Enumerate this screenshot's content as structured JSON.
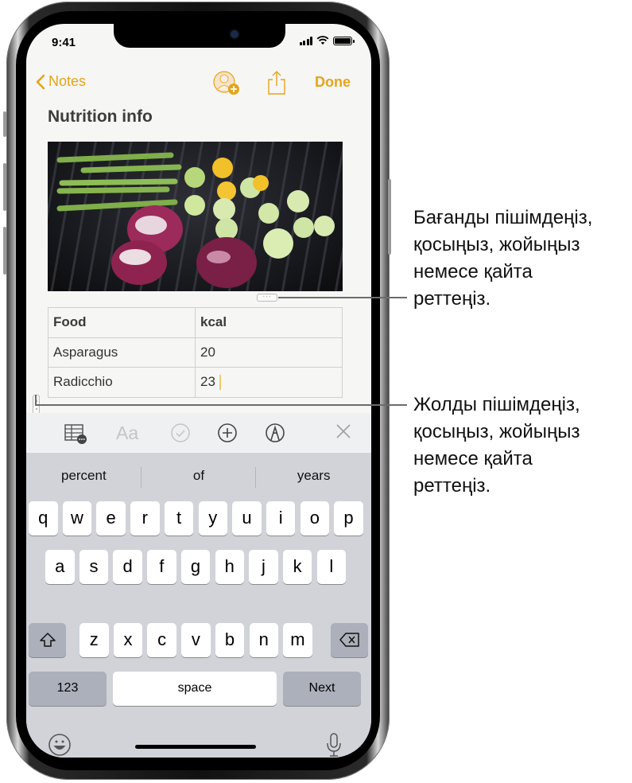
{
  "status_bar": {
    "time": "9:41",
    "battery_level": 1.0
  },
  "nav": {
    "back_label": "Notes",
    "done_label": "Done"
  },
  "note": {
    "title": "Nutrition info"
  },
  "table": {
    "headers": [
      "Food",
      "kcal"
    ],
    "rows": [
      [
        "Asparagus",
        "20"
      ],
      [
        "Radicchio",
        "23"
      ]
    ]
  },
  "toolbar": {
    "icons": [
      "table-icon",
      "text-format-icon",
      "checklist-icon",
      "add-icon",
      "markup-icon",
      "close-icon"
    ]
  },
  "suggestions": [
    "percent",
    "of",
    "years"
  ],
  "keyboard": {
    "row1": [
      "q",
      "w",
      "e",
      "r",
      "t",
      "y",
      "u",
      "i",
      "o",
      "p"
    ],
    "row2": [
      "a",
      "s",
      "d",
      "f",
      "g",
      "h",
      "j",
      "k",
      "l"
    ],
    "row3": [
      "z",
      "x",
      "c",
      "v",
      "b",
      "n",
      "m"
    ],
    "numbers_label": "123",
    "space_label": "space",
    "next_label": "Next"
  },
  "callouts": {
    "column": [
      "Бағанды пішімдеңіз,",
      "қосыңыз, жойыңыз",
      "немесе қайта",
      "реттеңіз."
    ],
    "row": [
      "Жолды пішімдеңіз,",
      "қосыңыз, жойыңыз",
      "немесе қайта",
      "реттеңіз."
    ]
  },
  "colors": {
    "accent": "#e5a41b",
    "keyboard_bg": "#d1d3d9",
    "toolbar_bg": "#eff0f2"
  }
}
